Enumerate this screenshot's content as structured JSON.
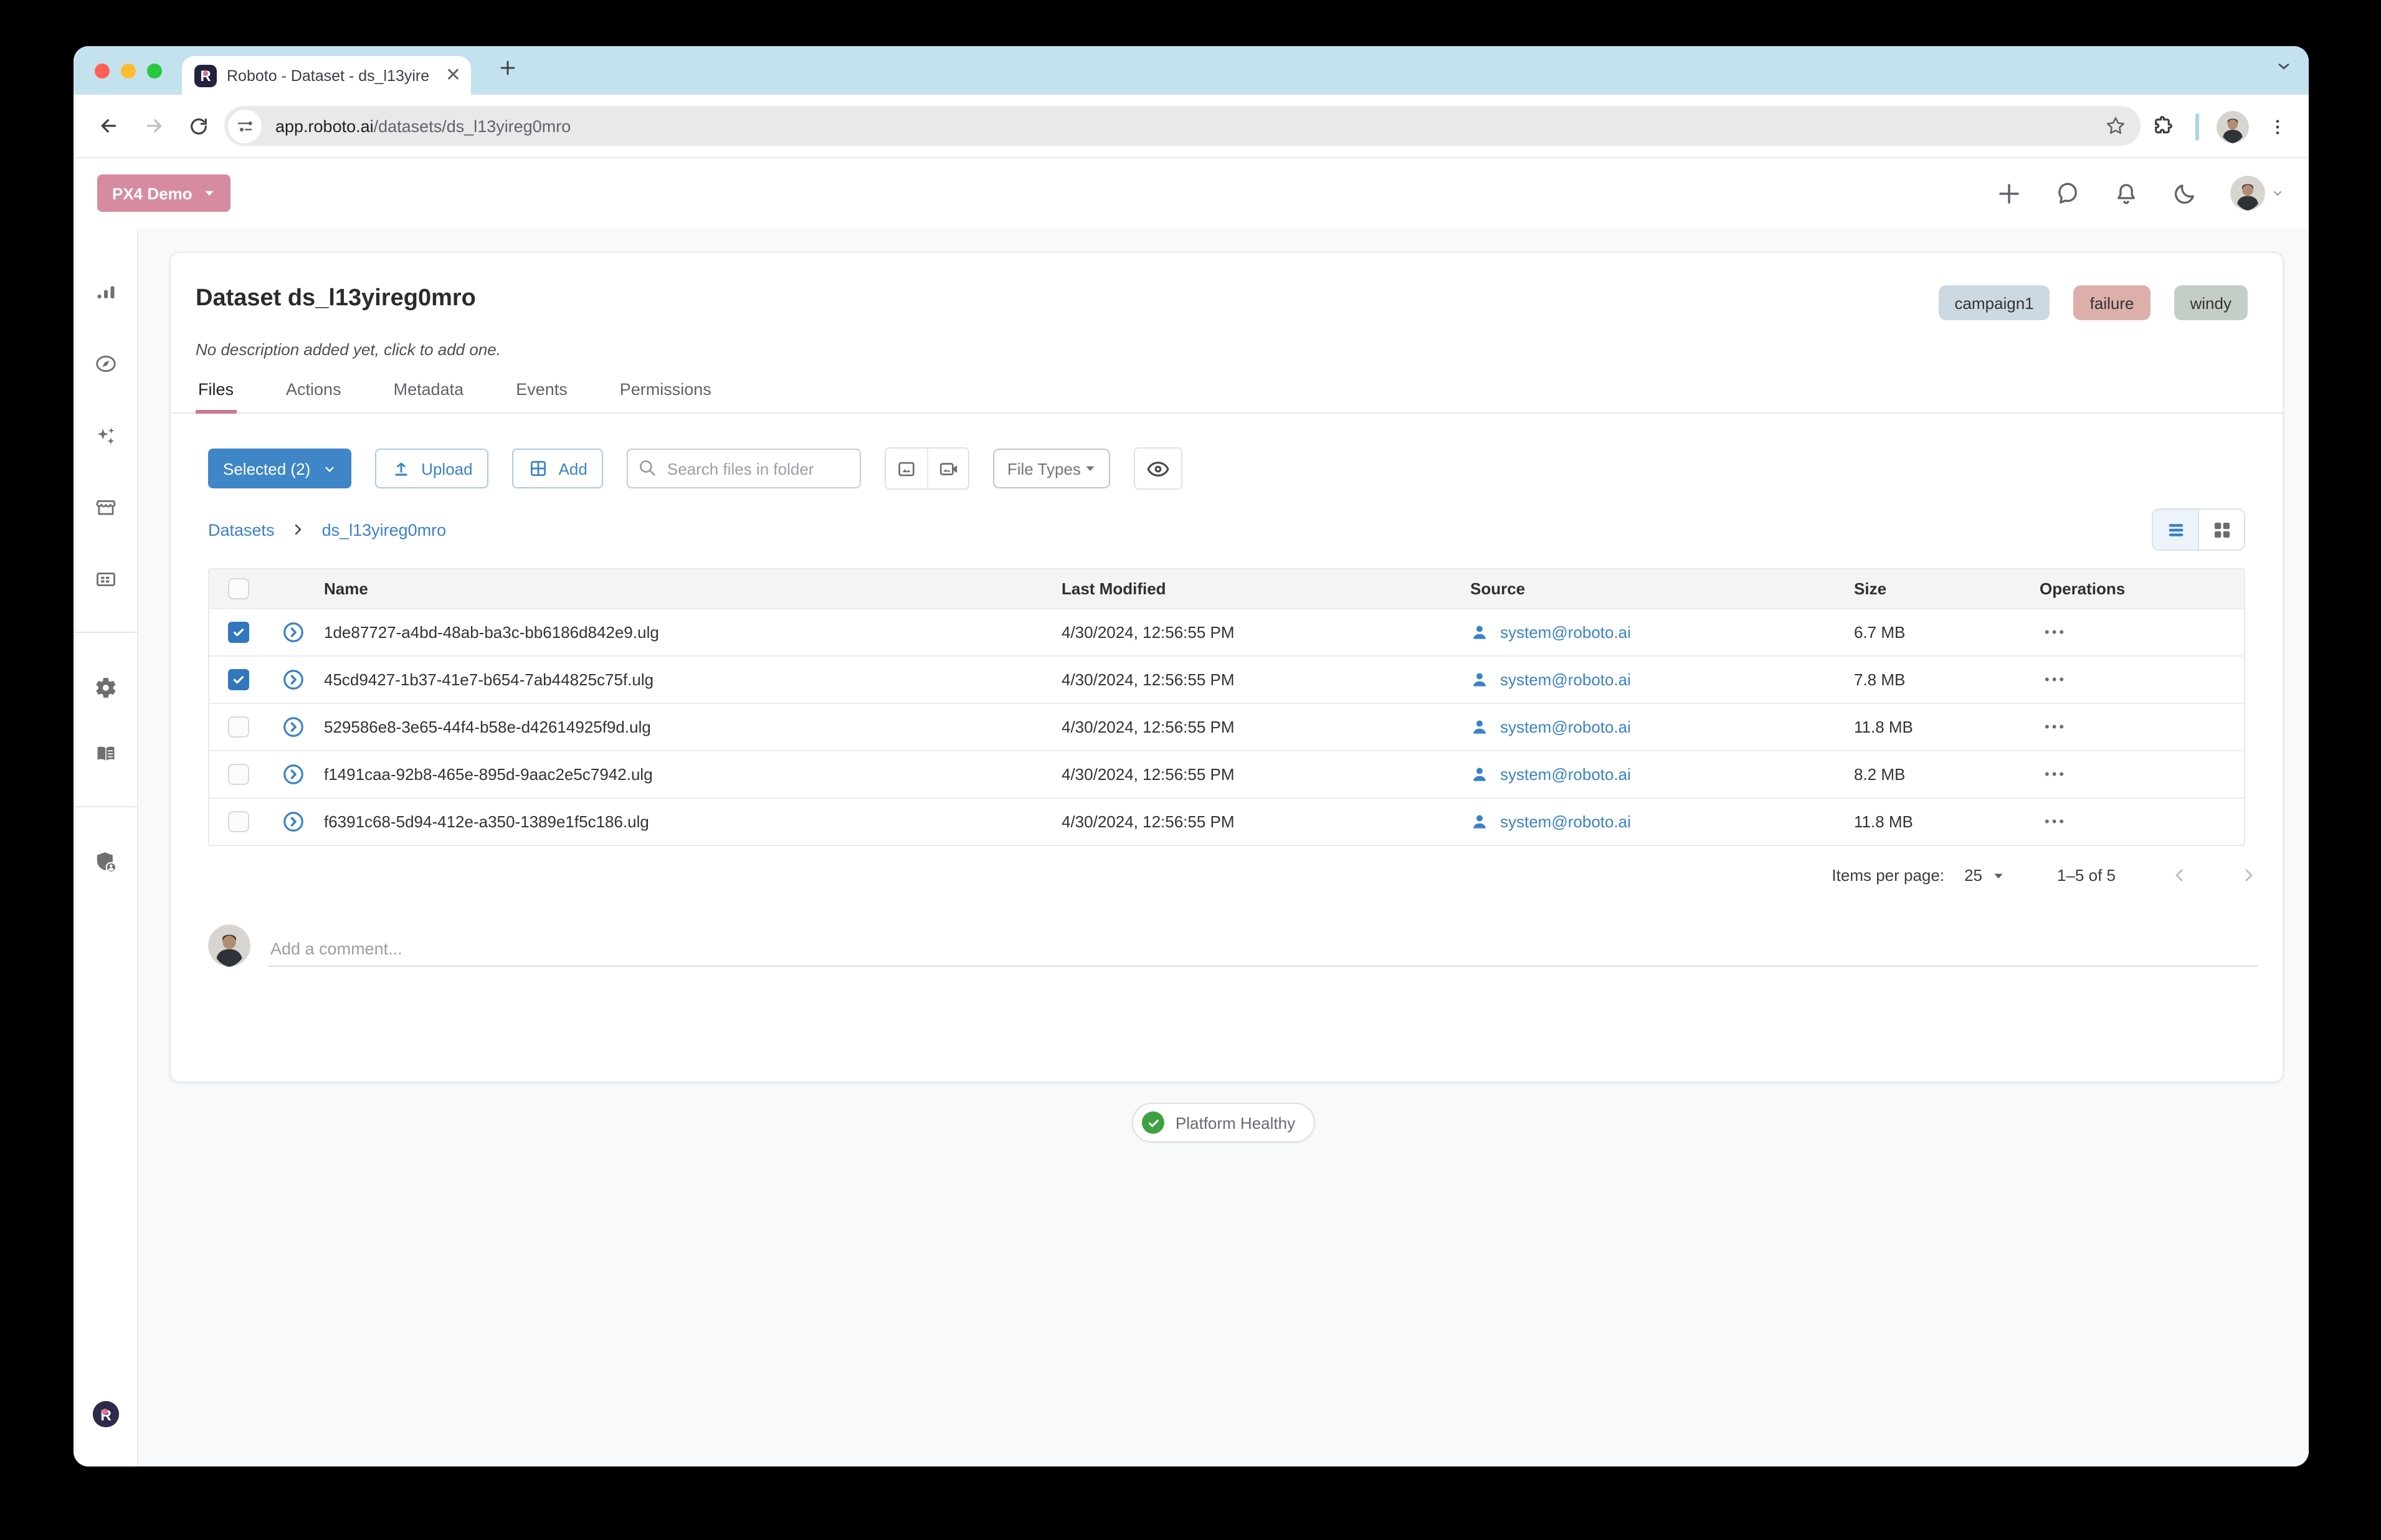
{
  "browser": {
    "tab_title": "Roboto - Dataset - ds_l13yire",
    "url_host": "app.roboto.ai",
    "url_path": "/datasets/ds_l13yireg0mro"
  },
  "header": {
    "org_button": "PX4 Demo"
  },
  "dataset": {
    "title": "Dataset ds_l13yireg0mro",
    "description_hint": "No description added yet, click to add one.",
    "tags": [
      {
        "label": "campaign1",
        "bg": "#cdd9e2"
      },
      {
        "label": "failure",
        "bg": "#dcafab"
      },
      {
        "label": "windy",
        "bg": "#c3cfc6"
      }
    ],
    "tabs": [
      {
        "label": "Files",
        "active": true
      },
      {
        "label": "Actions",
        "active": false
      },
      {
        "label": "Metadata",
        "active": false
      },
      {
        "label": "Events",
        "active": false
      },
      {
        "label": "Permissions",
        "active": false
      }
    ]
  },
  "toolbar": {
    "selected_label": "Selected (2)",
    "upload_label": "Upload",
    "add_label": "Add",
    "search_placeholder": "Search files in folder",
    "file_types_label": "File Types"
  },
  "breadcrumb": {
    "root": "Datasets",
    "current": "ds_l13yireg0mro"
  },
  "files_table": {
    "columns": [
      "Name",
      "Last Modified",
      "Source",
      "Size",
      "Operations"
    ],
    "operations_glyph": "•••",
    "rows": [
      {
        "checked": true,
        "name": "1de87727-a4bd-48ab-ba3c-bb6186d842e9.ulg",
        "modified": "4/30/2024, 12:56:55 PM",
        "source": "system@roboto.ai",
        "size": "6.7 MB"
      },
      {
        "checked": true,
        "name": "45cd9427-1b37-41e7-b654-7ab44825c75f.ulg",
        "modified": "4/30/2024, 12:56:55 PM",
        "source": "system@roboto.ai",
        "size": "7.8 MB"
      },
      {
        "checked": false,
        "name": "529586e8-3e65-44f4-b58e-d42614925f9d.ulg",
        "modified": "4/30/2024, 12:56:55 PM",
        "source": "system@roboto.ai",
        "size": "11.8 MB"
      },
      {
        "checked": false,
        "name": "f1491caa-92b8-465e-895d-9aac2e5c7942.ulg",
        "modified": "4/30/2024, 12:56:55 PM",
        "source": "system@roboto.ai",
        "size": "8.2 MB"
      },
      {
        "checked": false,
        "name": "f6391c68-5d94-412e-a350-1389e1f5c186.ulg",
        "modified": "4/30/2024, 12:56:55 PM",
        "source": "system@roboto.ai",
        "size": "11.8 MB"
      }
    ]
  },
  "pagination": {
    "items_per_page_label": "Items per page:",
    "per_page": "25",
    "range": "1–5 of 5"
  },
  "comment": {
    "placeholder": "Add a comment..."
  },
  "status": {
    "label": "Platform Healthy",
    "color": "#3fa142"
  },
  "colors": {
    "primary_blue": "#3e86c7",
    "link_blue": "#3b82c6",
    "brand_pink": "#d78ba0",
    "tab_underline": "#ca7a90",
    "tabstrip": "#c3e2ee"
  },
  "icons": {
    "favicon": "roboto-r-logo",
    "back": "arrow-left",
    "forward": "arrow-right",
    "reload": "circular-arrow",
    "site_info": "tune-sliders",
    "bookmark": "star-outline",
    "extensions": "puzzle",
    "menu": "kebab-dots",
    "new": "plus",
    "feedback": "chat-bubble",
    "notifications": "bell",
    "dark_mode": "crescent-moon",
    "sidebar": [
      "bar-chart",
      "compass",
      "sparkles",
      "storefront",
      "card-view",
      "gear",
      "book",
      "shield-user",
      "roboto-logo"
    ],
    "upload": "arrow-up-from-line",
    "add": "grid-2x2",
    "search": "magnifier",
    "image": "picture",
    "video": "video-camera",
    "visibility": "eye",
    "list_view": "three-bars",
    "grid_view": "four-squares",
    "user": "person",
    "expand_row": "circle-chevron-right",
    "healthy": "check-circle"
  }
}
